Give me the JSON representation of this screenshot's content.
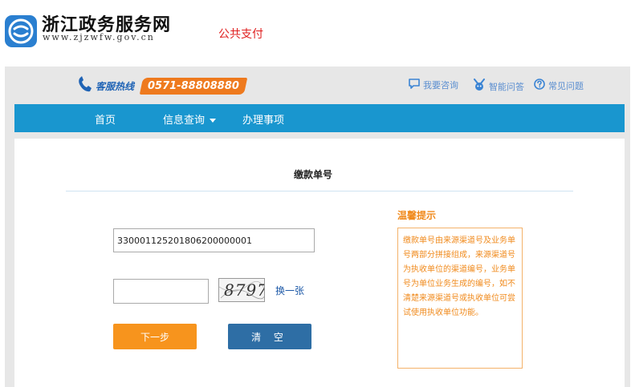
{
  "header": {
    "site_name": "浙江政务服务网",
    "site_url": "www.zjzwfw.gov.cn",
    "section": "公共支付"
  },
  "service_bar": {
    "hotline_label": "客服热线",
    "hotline_number": "0571-88808880",
    "links": [
      {
        "label": "我要咨询",
        "icon": "chat-icon"
      },
      {
        "label": "智能问答",
        "icon": "robot-icon"
      },
      {
        "label": "常见问题",
        "icon": "question-icon"
      }
    ]
  },
  "nav": {
    "items": [
      "首页",
      "信息查询",
      "办理事项"
    ]
  },
  "form": {
    "title": "缴款单号",
    "payment_number": "330001125201806200000001",
    "captcha_value": "",
    "captcha_text": "8797",
    "refresh_label": "换一张",
    "next_label": "下一步",
    "clear_label": "清 空"
  },
  "tips": {
    "title": "温馨提示",
    "text": "缴款单号由来源渠道号及业务单号两部分拼接组成，来源渠道号为执收单位的渠道编号，业务单号为单位业务生成的编号，如不清楚来源渠道号或执收单位可尝试使用执收单位功能。"
  },
  "colors": {
    "nav_bg": "#1996cf",
    "hotline_bg": "#ee7a1e",
    "next_button": "#f7941d",
    "clear_button": "#2e6ea5",
    "tips_accent": "#f08a1c"
  }
}
